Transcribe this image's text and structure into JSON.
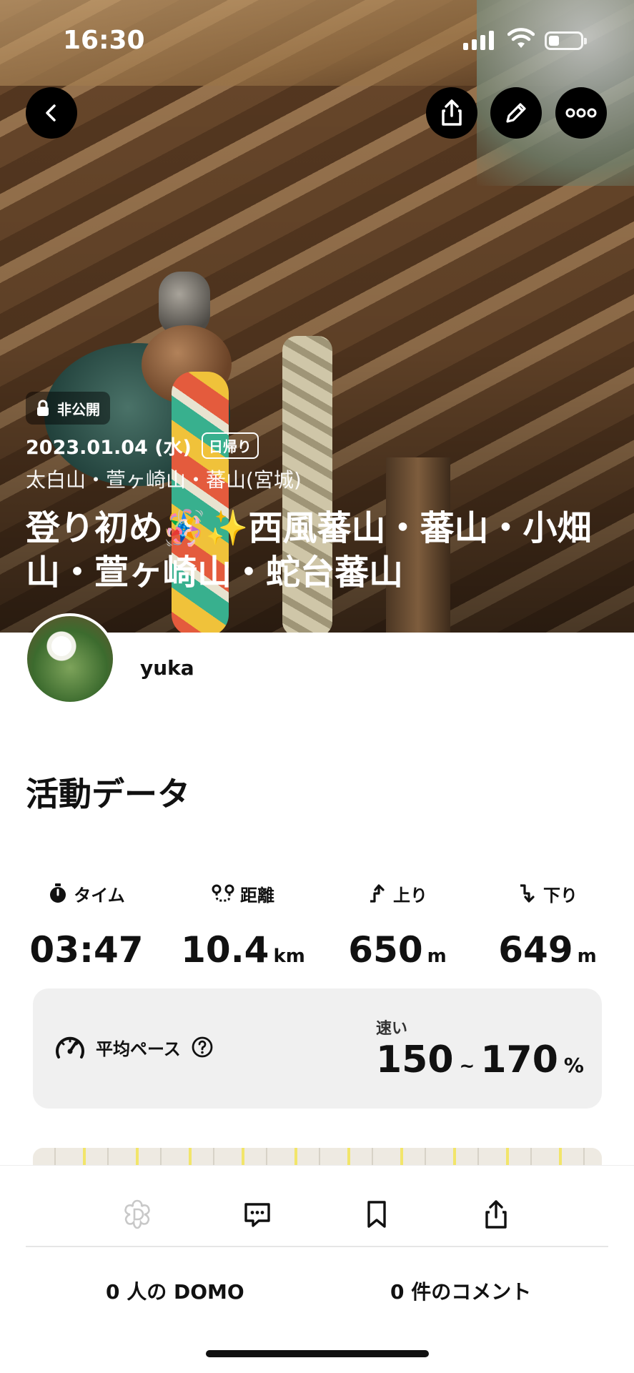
{
  "status_bar": {
    "time": "16:30"
  },
  "header": {
    "visibility_badge": "非公開",
    "date": "2023.01.04 (水)",
    "trip_type": "日帰り",
    "mountains": "太白山・萱ヶ崎山・蕃山(宮城)",
    "title": "登り初め🪅✨西風蕃山・蕃山・小畑山・萱ヶ崎山・蛇台蕃山"
  },
  "user": {
    "name": "yuka"
  },
  "activity": {
    "section_title": "活動データ",
    "stats": [
      {
        "label": "タイム",
        "value": "03:47",
        "unit": "",
        "icon": "stopwatch-icon"
      },
      {
        "label": "距離",
        "value": "10.4",
        "unit": "km",
        "icon": "route-icon"
      },
      {
        "label": "上り",
        "value": "650",
        "unit": "m",
        "icon": "ascent-icon"
      },
      {
        "label": "下り",
        "value": "649",
        "unit": "m",
        "icon": "descent-icon"
      }
    ],
    "pace": {
      "label": "平均ペース",
      "speed_label": "速い",
      "min": "150",
      "separator": "~",
      "max": "170",
      "unit": "%"
    }
  },
  "footer": {
    "domo_count": "0 人の DOMO",
    "comment_count": "0 件のコメント"
  }
}
